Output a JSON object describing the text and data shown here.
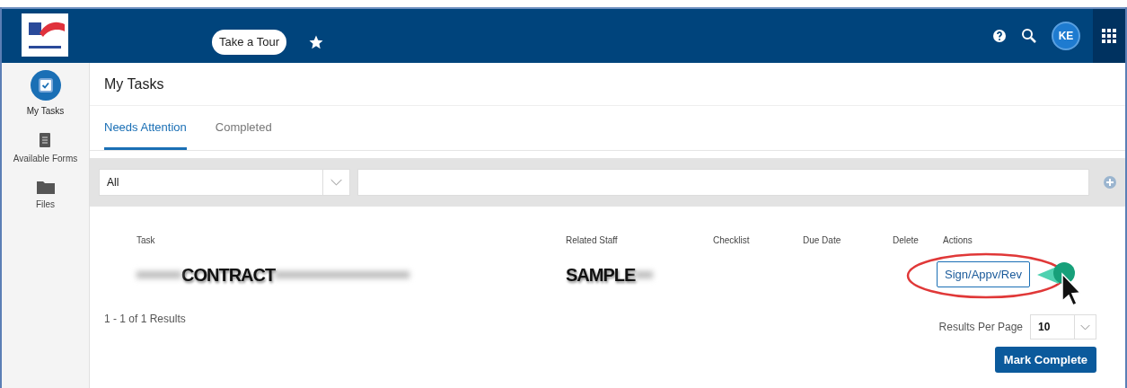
{
  "header": {
    "tour_button": "Take a Tour",
    "avatar": "KE"
  },
  "sidebar": {
    "items": [
      {
        "label": "My Tasks",
        "kind": "tasks",
        "selected": true
      },
      {
        "label": "Available Forms",
        "kind": "forms",
        "selected": false
      },
      {
        "label": "Files",
        "kind": "files",
        "selected": false
      }
    ]
  },
  "page_title": "My Tasks",
  "tabs": [
    {
      "label": "Needs Attention",
      "selected": true
    },
    {
      "label": "Completed",
      "selected": false
    }
  ],
  "filter": {
    "value": "All"
  },
  "table": {
    "columns": [
      "Task",
      "Related Staff",
      "Checklist",
      "Due Date",
      "Delete",
      "Actions"
    ],
    "rows": [
      {
        "task": "CONTRACT",
        "related_staff": "SAMPLE",
        "action": "Sign/Appv/Rev"
      }
    ]
  },
  "results": "1 - 1 of 1 Results",
  "results_per_page": {
    "label": "Results Per Page",
    "value": "10"
  },
  "mark_complete": "Mark Complete"
}
